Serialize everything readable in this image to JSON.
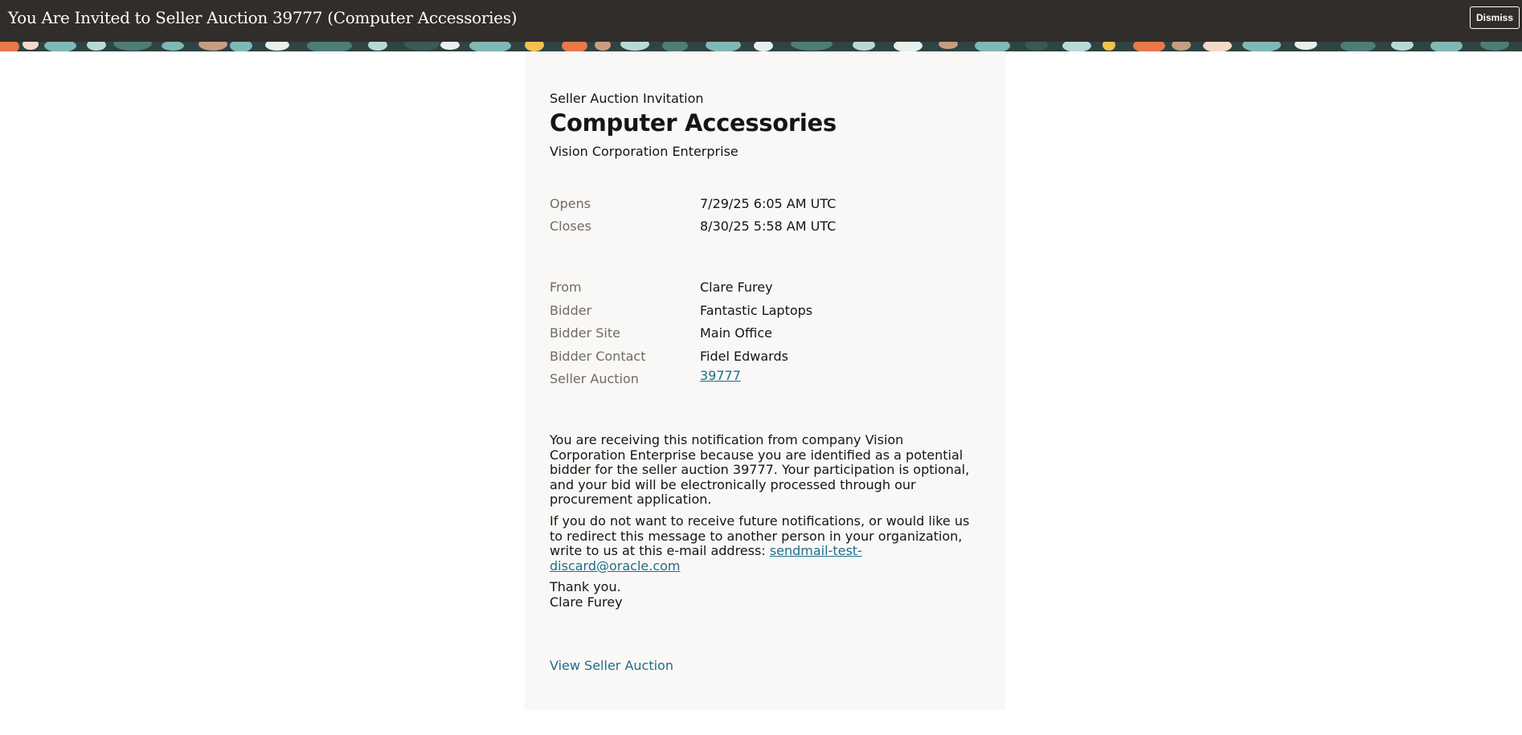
{
  "header": {
    "title": "You Are Invited to Seller Auction 39777 (Computer Accessories)",
    "dismiss_label": "Dismiss"
  },
  "card": {
    "eyebrow": "Seller Auction Invitation",
    "heading": "Computer Accessories",
    "organization": "Vision Corporation Enterprise",
    "schedule": [
      {
        "label": "Opens",
        "value": "7/29/25 6:05 AM UTC"
      },
      {
        "label": "Closes",
        "value": "8/30/25 5:58 AM UTC"
      }
    ],
    "details": [
      {
        "label": "From",
        "value": "Clare Furey"
      },
      {
        "label": "Bidder",
        "value": "Fantastic Laptops"
      },
      {
        "label": "Bidder Site",
        "value": "Main Office"
      },
      {
        "label": "Bidder Contact",
        "value": "Fidel Edwards"
      },
      {
        "label": "Seller Auction",
        "value": "39777"
      }
    ],
    "paragraph1": "You are receiving this notification from company Vision Corporation Enterprise because you are identified as a potential bidder for the seller auction 39777. Your participation is optional, and your bid will be electronically processed through our procurement application.",
    "paragraph2_text": "If you do not want to receive future notifications, or would like us to redirect this message to another person in your organization, write to us at this e-mail address: ",
    "paragraph2_email": "sendmail-test-discard@oracle.com",
    "signoff_line1": "Thank you.",
    "signoff_line2": "Clare Furey",
    "view_link": "View Seller Auction"
  },
  "colors": {
    "topbar": "#312d2a",
    "card_background": "#f9f8f6",
    "link": "#1e6e8c",
    "label": "#6f6b65"
  }
}
